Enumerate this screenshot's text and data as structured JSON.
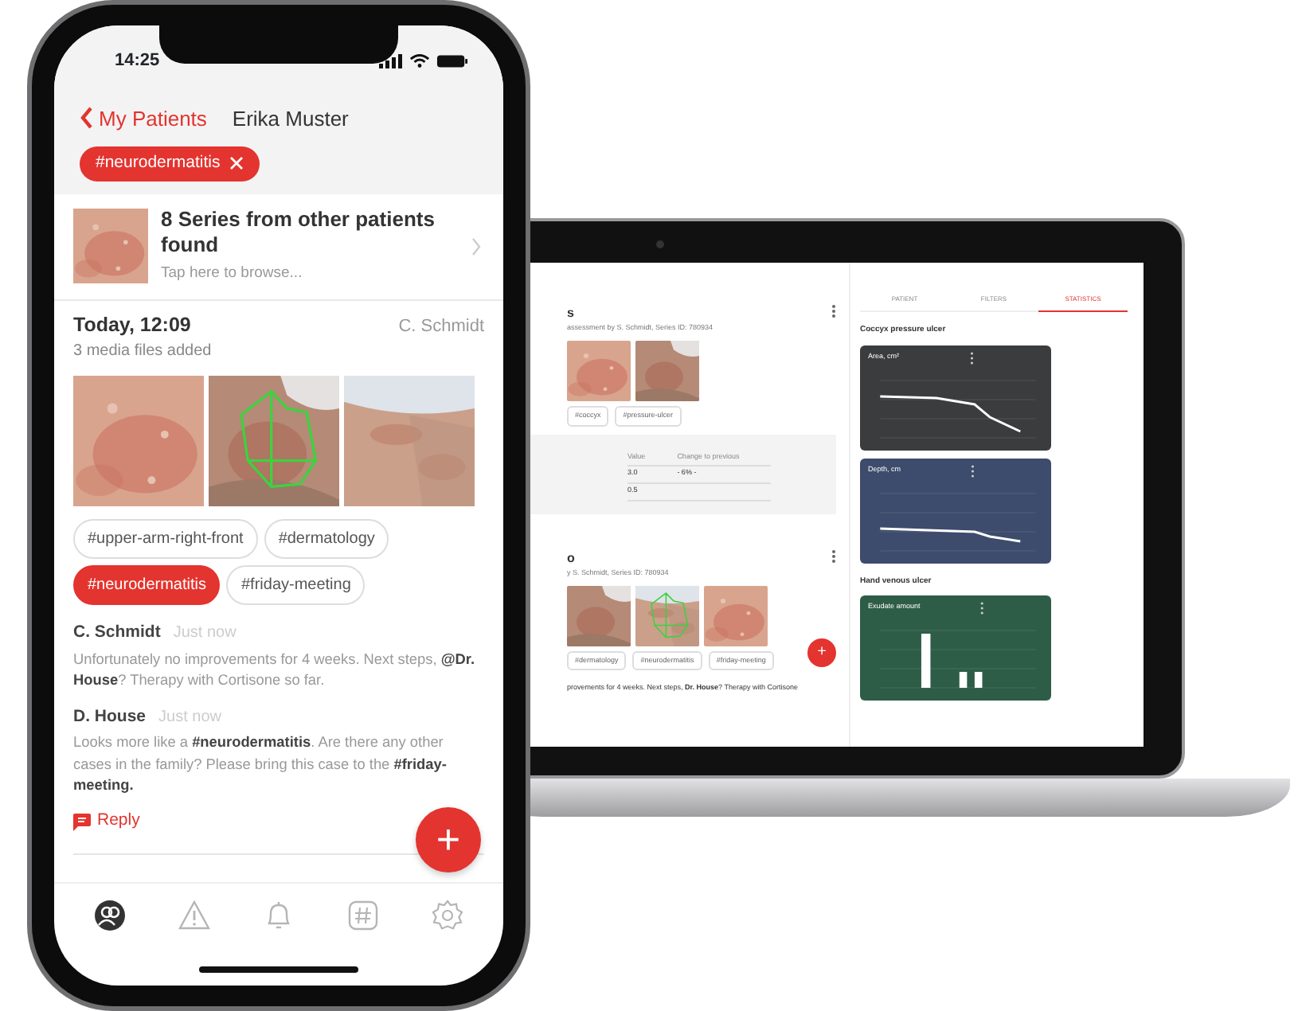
{
  "laptop": {
    "series": [
      {
        "title": "s",
        "subtitle": "assessment by S. Schmidt, Series ID: 780934",
        "media": [
          {
            "annotated": false
          },
          {
            "annotated": false
          }
        ],
        "tags": [
          "#coccyx",
          "#pressure-ulcer"
        ],
        "table": {
          "columns": [
            "Value",
            "Change to previous"
          ],
          "rows": [
            [
              "3.0",
              "- 6% -"
            ],
            [
              "0.5",
              ""
            ]
          ]
        }
      },
      {
        "title": "o",
        "subtitle": "y S. Schmidt, Series ID: 780934",
        "media": [
          {
            "annotated": false
          },
          {
            "annotated": true
          },
          {
            "annotated": false
          }
        ],
        "tags": [
          "#dermatology",
          "#neurodermatitis",
          "#friday-meeting"
        ],
        "comment": "provements for 4 weeks. Next steps, **Dr. House**? Therapy with Cortisone"
      }
    ],
    "fab": "+",
    "tabs": [
      {
        "label": "PATIENT",
        "selected": false
      },
      {
        "label": "FILTERS",
        "selected": false
      },
      {
        "label": "STATISTICS",
        "selected": true
      }
    ],
    "groups": [
      {
        "title": "Coccyx pressure ulcer",
        "charts": [
          {
            "title": "Area, cm²",
            "kind": "line",
            "color": "#3b3c3e"
          },
          {
            "title": "Depth, cm",
            "kind": "line",
            "color": "#3d4b6c"
          }
        ]
      },
      {
        "title": "Hand venous ulcer",
        "charts": [
          {
            "title": "Exudate amount",
            "kind": "bar",
            "color": "#2e5d47"
          }
        ]
      }
    ]
  },
  "phone": {
    "status_bar": {
      "time": "14:25"
    },
    "header": {
      "back_label": "My Patients",
      "title": "Erika Muster"
    },
    "filter_chip": {
      "label": "#neurodermatitis"
    },
    "series_card": {
      "title": "8 Series from other patients found",
      "subtitle": "Tap here to browse..."
    },
    "post": {
      "time": "Today, 12:09",
      "author": "C. Schmidt",
      "summary": "3 media files added",
      "media": [
        {
          "annotated": false
        },
        {
          "annotated": true
        },
        {
          "annotated": false
        }
      ],
      "tags": [
        {
          "label": "#upper-arm-right-front",
          "selected": false
        },
        {
          "label": "#dermatology",
          "selected": false
        },
        {
          "label": "#neurodermatitis",
          "selected": true
        },
        {
          "label": "#friday-meeting",
          "selected": false
        }
      ]
    },
    "comments": [
      {
        "author": "C. Schmidt",
        "time": "Just now",
        "text": "Unfortunately no improvements for 4 weeks. Next steps, **@Dr. House**? Therapy with Cortisone so far."
      },
      {
        "author": "D. House",
        "time": "Just now",
        "text": "Looks more like a **#neurodermatitis**. Are there any other cases in the family? Please bring this case to the **#friday-meeting.**"
      }
    ],
    "reply": "Reply",
    "fab": "+",
    "tab_bar": [
      {
        "selected": true
      },
      {
        "selected": false
      },
      {
        "selected": false
      },
      {
        "selected": false
      },
      {
        "selected": false
      }
    ]
  }
}
